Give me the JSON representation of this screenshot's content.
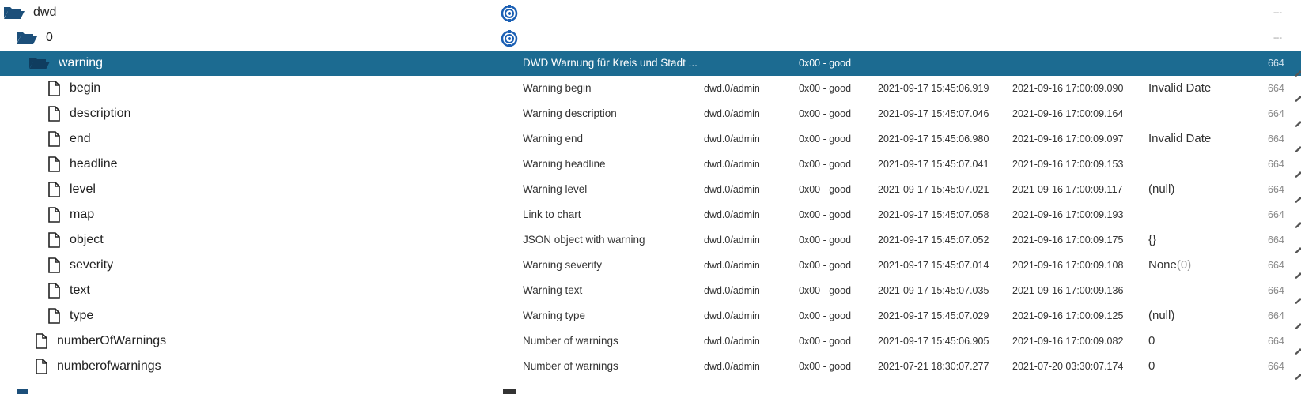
{
  "rows": [
    {
      "name": "dwd",
      "desc": "",
      "role": "",
      "status": "",
      "ts": "",
      "lc": "",
      "val": "",
      "val_sub": "",
      "acl": "---",
      "type": "folder"
    },
    {
      "name": "0",
      "desc": "",
      "role": "",
      "status": "",
      "ts": "",
      "lc": "",
      "val": "",
      "val_sub": "",
      "acl": "---",
      "type": "folder"
    },
    {
      "name": "warning",
      "desc": "DWD Warnung für Kreis und Stadt ...",
      "role": "",
      "status": "0x00 - good",
      "ts": "",
      "lc": "",
      "val": "",
      "val_sub": "",
      "acl": "664",
      "type": "folder"
    },
    {
      "name": "begin",
      "desc": "Warning begin",
      "role": "dwd.0/admin",
      "status": "0x00 - good",
      "ts": "2021-09-17 15:45:06.919",
      "lc": "2021-09-16 17:00:09.090",
      "val": "Invalid Date",
      "val_sub": "",
      "acl": "664",
      "type": "file"
    },
    {
      "name": "description",
      "desc": "Warning description",
      "role": "dwd.0/admin",
      "status": "0x00 - good",
      "ts": "2021-09-17 15:45:07.046",
      "lc": "2021-09-16 17:00:09.164",
      "val": "",
      "val_sub": "",
      "acl": "664",
      "type": "file"
    },
    {
      "name": "end",
      "desc": "Warning end",
      "role": "dwd.0/admin",
      "status": "0x00 - good",
      "ts": "2021-09-17 15:45:06.980",
      "lc": "2021-09-16 17:00:09.097",
      "val": "Invalid Date",
      "val_sub": "",
      "acl": "664",
      "type": "file"
    },
    {
      "name": "headline",
      "desc": "Warning headline",
      "role": "dwd.0/admin",
      "status": "0x00 - good",
      "ts": "2021-09-17 15:45:07.041",
      "lc": "2021-09-16 17:00:09.153",
      "val": "",
      "val_sub": "",
      "acl": "664",
      "type": "file"
    },
    {
      "name": "level",
      "desc": "Warning level",
      "role": "dwd.0/admin",
      "status": "0x00 - good",
      "ts": "2021-09-17 15:45:07.021",
      "lc": "2021-09-16 17:00:09.117",
      "val": "(null)",
      "val_sub": "",
      "acl": "664",
      "type": "file"
    },
    {
      "name": "map",
      "desc": "Link to chart",
      "role": "dwd.0/admin",
      "status": "0x00 - good",
      "ts": "2021-09-17 15:45:07.058",
      "lc": "2021-09-16 17:00:09.193",
      "val": "",
      "val_sub": "",
      "acl": "664",
      "type": "file"
    },
    {
      "name": "object",
      "desc": "JSON object with warning",
      "role": "dwd.0/admin",
      "status": "0x00 - good",
      "ts": "2021-09-17 15:45:07.052",
      "lc": "2021-09-16 17:00:09.175",
      "val": "{}",
      "val_sub": "",
      "acl": "664",
      "type": "file"
    },
    {
      "name": "severity",
      "desc": "Warning severity",
      "role": "dwd.0/admin",
      "status": "0x00 - good",
      "ts": "2021-09-17 15:45:07.014",
      "lc": "2021-09-16 17:00:09.108",
      "val": "None",
      "val_sub": "(0)",
      "acl": "664",
      "type": "file"
    },
    {
      "name": "text",
      "desc": "Warning text",
      "role": "dwd.0/admin",
      "status": "0x00 - good",
      "ts": "2021-09-17 15:45:07.035",
      "lc": "2021-09-16 17:00:09.136",
      "val": "",
      "val_sub": "",
      "acl": "664",
      "type": "file"
    },
    {
      "name": "type",
      "desc": "Warning type",
      "role": "dwd.0/admin",
      "status": "0x00 - good",
      "ts": "2021-09-17 15:45:07.029",
      "lc": "2021-09-16 17:00:09.125",
      "val": "(null)",
      "val_sub": "",
      "acl": "664",
      "type": "file"
    },
    {
      "name": "numberOfWarnings",
      "desc": "Number of warnings",
      "role": "dwd.0/admin",
      "status": "0x00 - good",
      "ts": "2021-09-17 15:45:06.905",
      "lc": "2021-09-16 17:00:09.082",
      "val": "0",
      "val_sub": "",
      "acl": "664",
      "type": "file"
    },
    {
      "name": "numberofwarnings",
      "desc": "Number of warnings",
      "role": "dwd.0/admin",
      "status": "0x00 - good",
      "ts": "2021-07-21 18:30:07.277",
      "lc": "2021-07-20 03:30:07.174",
      "val": "0",
      "val_sub": "",
      "acl": "664",
      "type": "file"
    }
  ],
  "icons": {
    "folder": "folder-open-icon",
    "file": "file-icon",
    "instance": "dwd-instance-icon",
    "edit": "pencil-icon"
  },
  "colors": {
    "selected_bg": "#1c6b91",
    "folder": "#1c4f7a",
    "instance_icon": "#1a5fb4"
  }
}
